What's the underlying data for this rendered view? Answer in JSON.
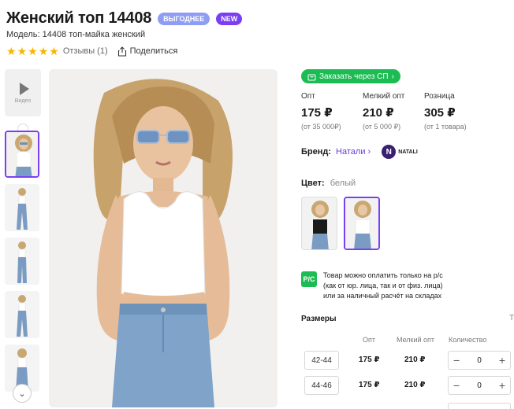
{
  "product": {
    "title": "Женский топ 14408",
    "badges": [
      "ВЫГОДНЕЕ",
      "NEW"
    ],
    "model": "Модель: 14408 топ-майка женский",
    "rating_stars": 5,
    "reviews": "Отзывы (1)",
    "share": "Поделиться"
  },
  "gallery": {
    "video_label": "Видео",
    "thumbnail_count": 5
  },
  "order_button": "Заказать через СП",
  "prices": [
    {
      "label": "Опт",
      "value": "175 ₽",
      "note": "(от 35 000₽)"
    },
    {
      "label": "Мелкий опт",
      "value": "210 ₽",
      "note": "(от 5 000 ₽)"
    },
    {
      "label": "Розница",
      "value": "305 ₽",
      "note": "(от 1 товара)"
    }
  ],
  "brand": {
    "label": "Бренд:",
    "name": "Натали",
    "logo_text": "NATALI",
    "logo_letter": "N"
  },
  "color": {
    "label": "Цвет:",
    "value": "белый"
  },
  "payment_icon": "P/C",
  "payment_note": [
    "Товар можно оплатить только на р/с",
    "(как от юр. лица, так и от физ. лица)",
    "или за наличный расчёт на складах"
  ],
  "sizes": {
    "title": "Размеры",
    "side_mark": "Т",
    "columns": [
      "Опт",
      "Мелкий опт",
      "Количество"
    ],
    "rows": [
      {
        "size": "42-44",
        "opt": "175 ₽",
        "small_opt": "210 ₽",
        "qty": "0"
      },
      {
        "size": "44-46",
        "opt": "175 ₽",
        "small_opt": "210 ₽",
        "qty": "0"
      }
    ]
  },
  "colors": {
    "accent": "#7b3ff2",
    "green": "#1dbb54",
    "star": "#f7b500",
    "link": "#6a3cd9"
  }
}
